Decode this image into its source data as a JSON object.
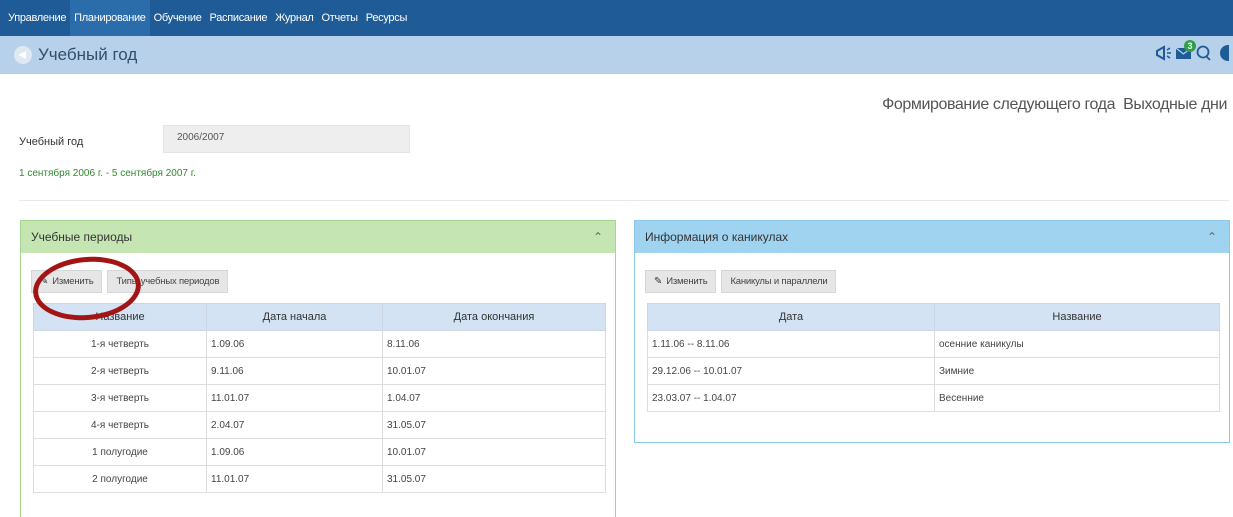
{
  "nav": {
    "items": [
      "Управление",
      "Планирование",
      "Обучение",
      "Расписание",
      "Журнал",
      "Отчеты",
      "Ресурсы"
    ],
    "active_index": 1
  },
  "header": {
    "title": "Учебный год",
    "icons": [
      "megaphone-icon",
      "mail-icon",
      "chat-icon",
      "help-icon"
    ],
    "mail_badge": "3"
  },
  "top_links": {
    "next_year": "Формирование следующего года",
    "holidays": "Выходные дни"
  },
  "year_form": {
    "label": "Учебный год",
    "value": "2006/2007",
    "range_text": "1 сентября 2006 г. - 5 сентября 2007 г."
  },
  "periods_panel": {
    "title": "Учебные периоды",
    "edit_button": "Изменить",
    "types_button": "Типы учебных периодов",
    "columns": [
      "Название",
      "Дата начала",
      "Дата окончания"
    ],
    "rows": [
      [
        "1-я четверть",
        "1.09.06",
        "8.11.06"
      ],
      [
        "2-я четверть",
        "9.11.06",
        "10.01.07"
      ],
      [
        "3-я четверть",
        "11.01.07",
        "1.04.07"
      ],
      [
        "4-я четверть",
        "2.04.07",
        "31.05.07"
      ],
      [
        "1 полугодие",
        "1.09.06",
        "10.01.07"
      ],
      [
        "2 полугодие",
        "11.01.07",
        "31.05.07"
      ]
    ]
  },
  "holidays_panel": {
    "title": "Информация о каникулах",
    "edit_button": "Изменить",
    "parallels_button": "Каникулы и параллели",
    "columns": [
      "Дата",
      "Название"
    ],
    "rows": [
      [
        "1.11.06 -- 8.11.06",
        "осенние каникулы"
      ],
      [
        "29.12.06 -- 10.01.07",
        "Зимние"
      ],
      [
        "23.03.07 -- 1.04.07",
        "Весенние"
      ]
    ]
  },
  "colors": {
    "nav_bg": "#1f5b97",
    "title_bar_bg": "#b8d1ea",
    "periods_header": "#c5e6b3",
    "holidays_header": "#9fd3f0",
    "range_text": "#2f8a2f",
    "highlight_circle": "#a31515"
  }
}
